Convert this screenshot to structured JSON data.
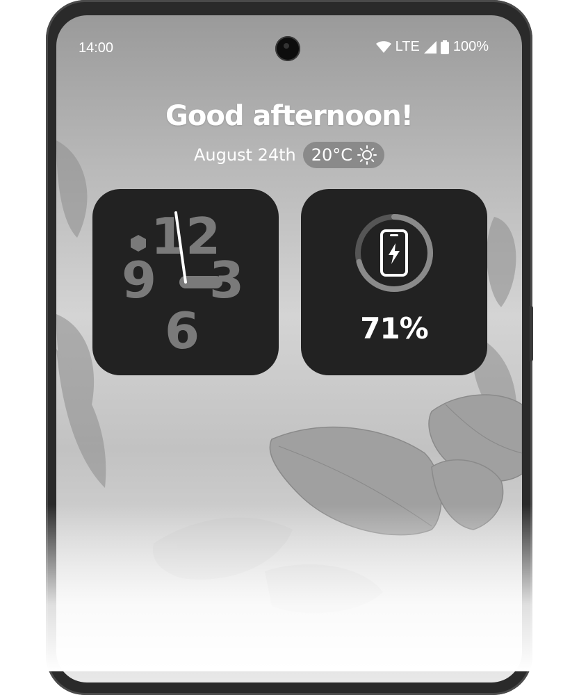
{
  "status_bar": {
    "time": "14:00",
    "network": "LTE",
    "battery": "100%",
    "icons": [
      "wifi-icon",
      "signal-icon",
      "battery-icon"
    ]
  },
  "header": {
    "greeting": "Good afternoon!",
    "date": "August 24th",
    "temperature": "20°C",
    "weather_icon": "sun-icon"
  },
  "clock_widget": {
    "numerals": [
      "12",
      "3",
      "6",
      "9"
    ],
    "icons": [
      "hexagon-icon"
    ]
  },
  "battery_widget": {
    "percent": "71%",
    "level": 0.71,
    "icon": "phone-charging-icon"
  },
  "colors": {
    "widget_bg": "#222222",
    "clock_numeral": "#7a7a7a",
    "ring_track": "#555555",
    "ring_fill": "#8a8a8a"
  }
}
